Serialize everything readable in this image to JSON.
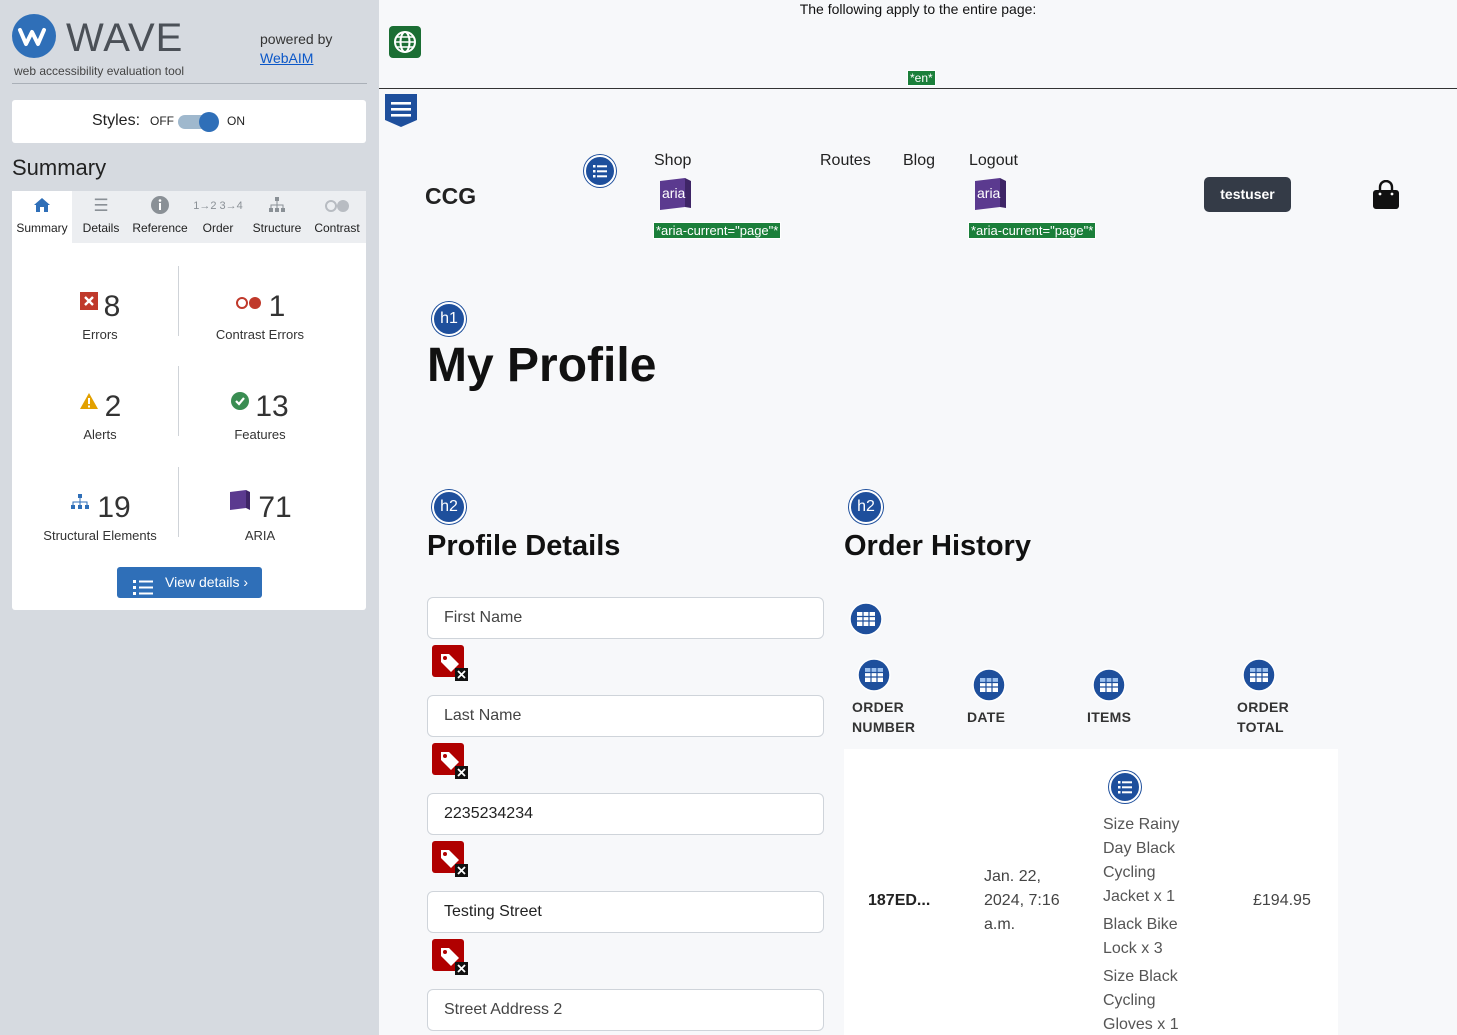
{
  "wave": {
    "name": "WAVE",
    "subtitle": "web accessibility evaluation tool",
    "powered_by": "powered by",
    "powered_link": "WebAIM",
    "styles_label": "Styles:",
    "styles_off": "OFF",
    "styles_on": "ON",
    "styles_enabled": true,
    "summary_title": "Summary",
    "tabs": [
      {
        "label": "Summary",
        "icon": "home-icon",
        "active": true
      },
      {
        "label": "Details",
        "icon": "list-icon"
      },
      {
        "label": "Reference",
        "icon": "info-icon"
      },
      {
        "label": "Order",
        "icon": "order-icon"
      },
      {
        "label": "Structure",
        "icon": "structure-icon"
      },
      {
        "label": "Contrast",
        "icon": "contrast-icon"
      }
    ],
    "stats": {
      "errors": {
        "count": "8",
        "label": "Errors",
        "icon": "error-icon",
        "color": "#c0392b"
      },
      "contrast": {
        "count": "1",
        "label": "Contrast Errors",
        "icon": "contrast-error-icon",
        "color": "#c0392b"
      },
      "alerts": {
        "count": "2",
        "label": "Alerts",
        "icon": "alert-icon",
        "color": "#e2a000"
      },
      "features": {
        "count": "13",
        "label": "Features",
        "icon": "feature-icon",
        "color": "#3a8d52"
      },
      "structural": {
        "count": "19",
        "label": "Structural Elements",
        "icon": "structure-icon",
        "color": "#2f6fb8"
      },
      "aria": {
        "count": "71",
        "label": "ARIA",
        "icon": "aria-icon",
        "color": "#5b3a8f"
      }
    },
    "view_details": "View details ›"
  },
  "page": {
    "apply_note": "The following apply to the entire page:",
    "lang_tag": "*en*",
    "brand": "CCG",
    "nav": {
      "shop": "Shop",
      "routes": "Routes",
      "blog": "Blog",
      "logout": "Logout",
      "aria_label": "aria",
      "aria_current_tag": "*aria-current=\"page\"*"
    },
    "user_button": "testuser",
    "h1_badge": "h1",
    "h2_badge": "h2",
    "title": "My Profile",
    "profile": {
      "heading": "Profile Details",
      "fields": [
        {
          "placeholder": "First Name",
          "value": ""
        },
        {
          "placeholder": "Last Name",
          "value": ""
        },
        {
          "placeholder": "",
          "value": "2235234234"
        },
        {
          "placeholder": "",
          "value": "Testing Street"
        },
        {
          "placeholder": "Street Address 2",
          "value": ""
        }
      ]
    },
    "orders": {
      "heading": "Order History",
      "headers": [
        "ORDER NUMBER",
        "DATE",
        "ITEMS",
        "ORDER TOTAL"
      ],
      "rows": [
        {
          "number": "187ED...",
          "date": "Jan. 22, 2024, 7:16 a.m.",
          "items": [
            "Size Rainy Day Black Cycling Jacket x 1",
            "Black Bike Lock x 3",
            "Size Black Cycling Gloves x 1"
          ],
          "total": "£194.95"
        }
      ]
    }
  }
}
